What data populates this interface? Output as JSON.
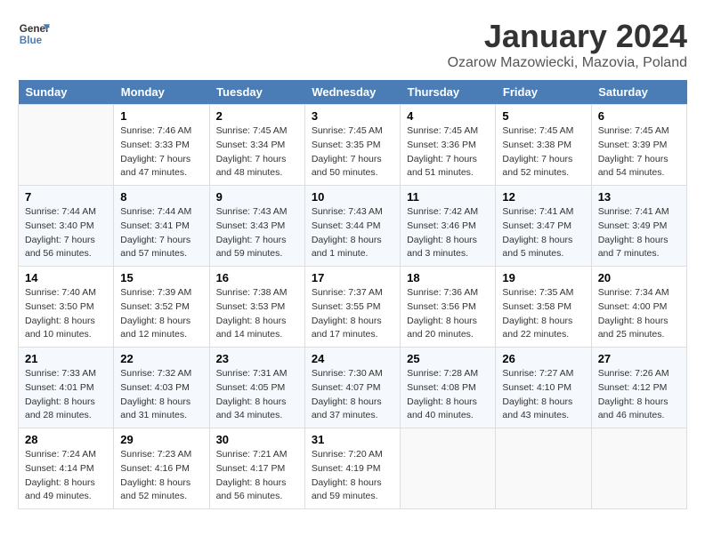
{
  "header": {
    "logo_line1": "General",
    "logo_line2": "Blue",
    "month": "January 2024",
    "location": "Ozarow Mazowiecki, Mazovia, Poland"
  },
  "weekdays": [
    "Sunday",
    "Monday",
    "Tuesday",
    "Wednesday",
    "Thursday",
    "Friday",
    "Saturday"
  ],
  "weeks": [
    [
      {
        "day": "",
        "info": ""
      },
      {
        "day": "1",
        "info": "Sunrise: 7:46 AM\nSunset: 3:33 PM\nDaylight: 7 hours\nand 47 minutes."
      },
      {
        "day": "2",
        "info": "Sunrise: 7:45 AM\nSunset: 3:34 PM\nDaylight: 7 hours\nand 48 minutes."
      },
      {
        "day": "3",
        "info": "Sunrise: 7:45 AM\nSunset: 3:35 PM\nDaylight: 7 hours\nand 50 minutes."
      },
      {
        "day": "4",
        "info": "Sunrise: 7:45 AM\nSunset: 3:36 PM\nDaylight: 7 hours\nand 51 minutes."
      },
      {
        "day": "5",
        "info": "Sunrise: 7:45 AM\nSunset: 3:38 PM\nDaylight: 7 hours\nand 52 minutes."
      },
      {
        "day": "6",
        "info": "Sunrise: 7:45 AM\nSunset: 3:39 PM\nDaylight: 7 hours\nand 54 minutes."
      }
    ],
    [
      {
        "day": "7",
        "info": "Sunrise: 7:44 AM\nSunset: 3:40 PM\nDaylight: 7 hours\nand 56 minutes."
      },
      {
        "day": "8",
        "info": "Sunrise: 7:44 AM\nSunset: 3:41 PM\nDaylight: 7 hours\nand 57 minutes."
      },
      {
        "day": "9",
        "info": "Sunrise: 7:43 AM\nSunset: 3:43 PM\nDaylight: 7 hours\nand 59 minutes."
      },
      {
        "day": "10",
        "info": "Sunrise: 7:43 AM\nSunset: 3:44 PM\nDaylight: 8 hours\nand 1 minute."
      },
      {
        "day": "11",
        "info": "Sunrise: 7:42 AM\nSunset: 3:46 PM\nDaylight: 8 hours\nand 3 minutes."
      },
      {
        "day": "12",
        "info": "Sunrise: 7:41 AM\nSunset: 3:47 PM\nDaylight: 8 hours\nand 5 minutes."
      },
      {
        "day": "13",
        "info": "Sunrise: 7:41 AM\nSunset: 3:49 PM\nDaylight: 8 hours\nand 7 minutes."
      }
    ],
    [
      {
        "day": "14",
        "info": "Sunrise: 7:40 AM\nSunset: 3:50 PM\nDaylight: 8 hours\nand 10 minutes."
      },
      {
        "day": "15",
        "info": "Sunrise: 7:39 AM\nSunset: 3:52 PM\nDaylight: 8 hours\nand 12 minutes."
      },
      {
        "day": "16",
        "info": "Sunrise: 7:38 AM\nSunset: 3:53 PM\nDaylight: 8 hours\nand 14 minutes."
      },
      {
        "day": "17",
        "info": "Sunrise: 7:37 AM\nSunset: 3:55 PM\nDaylight: 8 hours\nand 17 minutes."
      },
      {
        "day": "18",
        "info": "Sunrise: 7:36 AM\nSunset: 3:56 PM\nDaylight: 8 hours\nand 20 minutes."
      },
      {
        "day": "19",
        "info": "Sunrise: 7:35 AM\nSunset: 3:58 PM\nDaylight: 8 hours\nand 22 minutes."
      },
      {
        "day": "20",
        "info": "Sunrise: 7:34 AM\nSunset: 4:00 PM\nDaylight: 8 hours\nand 25 minutes."
      }
    ],
    [
      {
        "day": "21",
        "info": "Sunrise: 7:33 AM\nSunset: 4:01 PM\nDaylight: 8 hours\nand 28 minutes."
      },
      {
        "day": "22",
        "info": "Sunrise: 7:32 AM\nSunset: 4:03 PM\nDaylight: 8 hours\nand 31 minutes."
      },
      {
        "day": "23",
        "info": "Sunrise: 7:31 AM\nSunset: 4:05 PM\nDaylight: 8 hours\nand 34 minutes."
      },
      {
        "day": "24",
        "info": "Sunrise: 7:30 AM\nSunset: 4:07 PM\nDaylight: 8 hours\nand 37 minutes."
      },
      {
        "day": "25",
        "info": "Sunrise: 7:28 AM\nSunset: 4:08 PM\nDaylight: 8 hours\nand 40 minutes."
      },
      {
        "day": "26",
        "info": "Sunrise: 7:27 AM\nSunset: 4:10 PM\nDaylight: 8 hours\nand 43 minutes."
      },
      {
        "day": "27",
        "info": "Sunrise: 7:26 AM\nSunset: 4:12 PM\nDaylight: 8 hours\nand 46 minutes."
      }
    ],
    [
      {
        "day": "28",
        "info": "Sunrise: 7:24 AM\nSunset: 4:14 PM\nDaylight: 8 hours\nand 49 minutes."
      },
      {
        "day": "29",
        "info": "Sunrise: 7:23 AM\nSunset: 4:16 PM\nDaylight: 8 hours\nand 52 minutes."
      },
      {
        "day": "30",
        "info": "Sunrise: 7:21 AM\nSunset: 4:17 PM\nDaylight: 8 hours\nand 56 minutes."
      },
      {
        "day": "31",
        "info": "Sunrise: 7:20 AM\nSunset: 4:19 PM\nDaylight: 8 hours\nand 59 minutes."
      },
      {
        "day": "",
        "info": ""
      },
      {
        "day": "",
        "info": ""
      },
      {
        "day": "",
        "info": ""
      }
    ]
  ]
}
